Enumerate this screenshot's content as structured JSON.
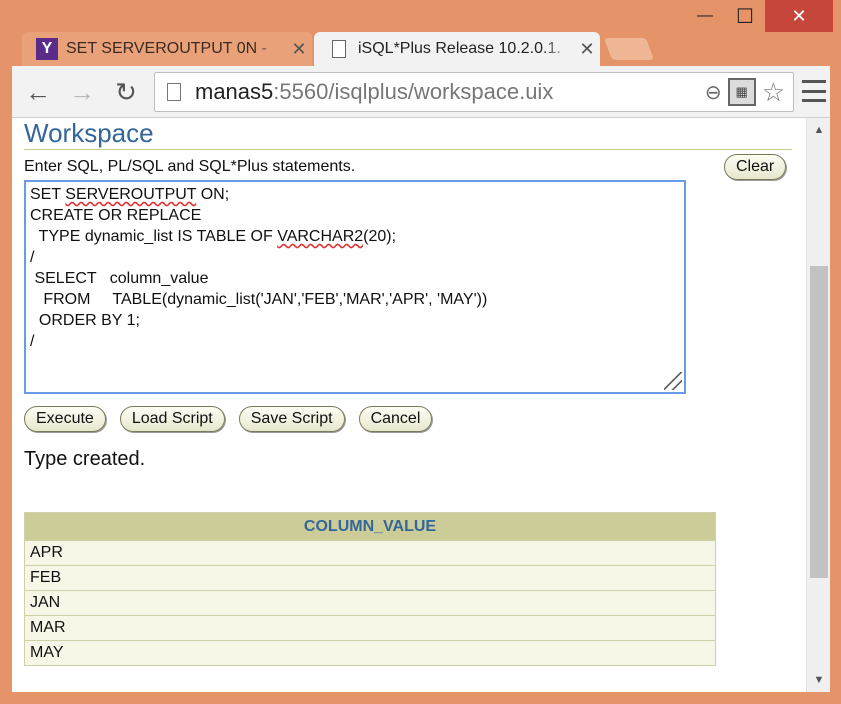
{
  "window": {
    "min_glyph": "—",
    "max_glyph": "☐",
    "close_glyph": "✕"
  },
  "tabs": [
    {
      "title": "SET SERVEROUTPUT 0N -",
      "favicon": "Y",
      "close": "✕"
    },
    {
      "title": "iSQL*Plus Release 10.2.0.1.",
      "close": "✕"
    }
  ],
  "toolbar": {
    "back_icon": "←",
    "forward_icon": "→",
    "reload_icon": "↻",
    "url_host": "manas5",
    "url_rest": ":5560/isqlplus/workspace.uix"
  },
  "page": {
    "title": "Workspace",
    "instructions": "Enter SQL, PL/SQL and SQL*Plus statements.",
    "clear_label": "Clear",
    "editor_lines": [
      {
        "pre": "SET ",
        "squig": "SERVEROUTPUT",
        "post": " ON;"
      },
      {
        "pre": "CREATE OR REPLACE",
        "squig": "",
        "post": ""
      },
      {
        "pre": "  TYPE dynamic_list IS TABLE OF ",
        "squig": "VARCHAR2",
        "post": "(20);"
      },
      {
        "pre": "/",
        "squig": "",
        "post": ""
      },
      {
        "pre": " SELECT   column_value",
        "squig": "",
        "post": ""
      },
      {
        "pre": "   FROM     TABLE(dynamic_list('JAN','FEB','MAR','APR', 'MAY'))",
        "squig": "",
        "post": ""
      },
      {
        "pre": "  ORDER BY 1;",
        "squig": "",
        "post": ""
      },
      {
        "pre": "/",
        "squig": "",
        "post": ""
      }
    ],
    "buttons": {
      "execute": "Execute",
      "load_script": "Load Script",
      "save_script": "Save Script",
      "cancel": "Cancel"
    },
    "result_message": "Type created.",
    "results_table": {
      "header": "COLUMN_VALUE",
      "rows": [
        "APR",
        "FEB",
        "JAN",
        "MAR",
        "MAY"
      ]
    }
  },
  "colors": {
    "accent": "#336699",
    "header_bg": "#cccc99",
    "row_bg": "#f7f7e7",
    "window_frame": "#e5946a"
  }
}
